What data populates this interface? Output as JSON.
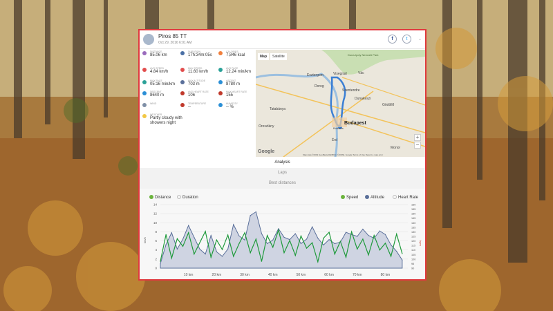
{
  "activity": {
    "title": "Piros 85 TT",
    "date": "Oct 29, 2016 6:01 AM"
  },
  "social": {
    "facebook": "f",
    "twitter": "t",
    "menu": "⌄"
  },
  "stats": [
    {
      "label": "Distance",
      "value": "85.06 km",
      "icon": "route-icon",
      "color": "#9a6bbd"
    },
    {
      "label": "Duration",
      "value": "17h:34m:05s",
      "icon": "clock-icon",
      "color": "#4a6fa5"
    },
    {
      "label": "Calories",
      "value": "7,846 kcal",
      "icon": "flame-icon",
      "color": "#f07f3c"
    },
    {
      "label": "Avg speed",
      "value": "4.84 km/h",
      "icon": "speed-icon",
      "color": "#e24d4d"
    },
    {
      "label": "Max speed",
      "value": "11.60 km/h",
      "icon": "speed-icon",
      "color": "#e24d4d"
    },
    {
      "label": "Avg pace",
      "value": "12.24 min/km",
      "icon": "pace-icon",
      "color": "#2aa198"
    },
    {
      "label": "Max pace",
      "value": "05:16 min/km",
      "icon": "pace-icon",
      "color": "#2aa198"
    },
    {
      "label": "Max altitude",
      "value": "703 m",
      "icon": "mountain-icon",
      "color": "#5a6f9a"
    },
    {
      "label": "Ascent",
      "value": "8780 m",
      "icon": "ascent-icon",
      "color": "#2a8fd6"
    },
    {
      "label": "Descent",
      "value": "8640 m",
      "icon": "descent-icon",
      "color": "#2a8fd6"
    },
    {
      "label": "Avg heart rate",
      "value": "106",
      "icon": "heart-icon",
      "color": "#c0392b"
    },
    {
      "label": "Max heart rate",
      "value": "155",
      "icon": "heart-icon",
      "color": "#c0392b"
    },
    {
      "label": "Wind",
      "value": "",
      "icon": "wind-icon",
      "color": "#7f8fa6"
    },
    {
      "label": "Temperature",
      "value": "--",
      "icon": "thermometer-icon",
      "color": "#c0392b"
    },
    {
      "label": "Humidity",
      "value": "-- %",
      "icon": "droplet-icon",
      "color": "#2a8fd6"
    },
    {
      "label": "Weather",
      "value": "Partly cloudy with showers night",
      "icon": "weather-icon",
      "color": "#f2c744"
    }
  ],
  "map": {
    "tab_map": "Map",
    "tab_satellite": "Satellite",
    "zoom_in": "+",
    "zoom_out": "−",
    "google": "Google",
    "attribution": "Map data ©2019 GeoBasis-DE/BKG (©2009), Google   Terms of Use   Report a map error",
    "places": [
      "Esztergom",
      "Visegrád",
      "Vác",
      "Szentendre",
      "Dunakeszi",
      "Tatabánya",
      "Budapest",
      "Érd",
      "Gödöllő",
      "Monor",
      "Oroszlány",
      "Budaörs",
      "Dorog",
      "Duna-Ipoly Nemzeti Park"
    ]
  },
  "tabs": {
    "analysis": "Analysis",
    "laps": "Laps",
    "best": "Best distances"
  },
  "toggles": {
    "distance": "Distance",
    "duration": "Duration",
    "speed": "Speed",
    "altitude": "Altitude",
    "heart_rate": "Heart Rate"
  },
  "chart_data": {
    "type": "line",
    "x": [
      0,
      2,
      4,
      6,
      8,
      10,
      12,
      14,
      16,
      18,
      20,
      22,
      24,
      26,
      28,
      30,
      32,
      34,
      36,
      38,
      40,
      42,
      44,
      46,
      48,
      50,
      52,
      54,
      56,
      58,
      60,
      62,
      64,
      66,
      68,
      70,
      72,
      74,
      76,
      78,
      80,
      82,
      84,
      86
    ],
    "xlabel": "",
    "x_ticks": [
      "10 km",
      "20 km",
      "30 km",
      "40 km",
      "50 km",
      "60 km",
      "70 km",
      "80 km"
    ],
    "x_tick_values": [
      10,
      20,
      30,
      40,
      50,
      60,
      70,
      80
    ],
    "xlim": [
      0,
      88
    ],
    "ylabel_left": "km/h",
    "ylim_left": [
      0,
      14
    ],
    "y_ticks_left": [
      "0",
      "2",
      "4",
      "6",
      "8",
      "10",
      "12",
      "14"
    ],
    "ylabel_right": "bpm",
    "ylim_right": [
      90,
      160
    ],
    "y_ticks_right": [
      "90",
      "95",
      "100",
      "105",
      "110",
      "115",
      "120",
      "125",
      "130",
      "135",
      "140",
      "145",
      "150",
      "155",
      "160"
    ],
    "series": [
      {
        "name": "Altitude",
        "type": "area",
        "color": "#5a6f9a",
        "fill": "#cfd4e2",
        "axis": "left",
        "values": [
          1,
          5.2,
          7.8,
          4.2,
          6.4,
          9.4,
          6.8,
          4.2,
          3.1,
          7.2,
          3.6,
          2.6,
          4.2,
          9.6,
          7.1,
          6.2,
          11.6,
          12.4,
          7.6,
          5.4,
          6.2,
          8.7,
          6.8,
          6.3,
          7.6,
          5.4,
          6.4,
          9.1,
          6.6,
          5.1,
          6.3,
          5.4,
          5.7,
          7.9,
          7.4,
          7.0,
          8.6,
          7.2,
          6.6,
          8.2,
          7.4,
          5.1,
          3.7,
          1.8
        ]
      },
      {
        "name": "Speed",
        "type": "line",
        "color": "#1f9a3b",
        "axis": "left",
        "values": [
          1.5,
          7.4,
          2.2,
          6.5,
          4.8,
          7.8,
          3.1,
          5.6,
          8.1,
          2.4,
          6.2,
          4.1,
          7.3,
          2.6,
          5.4,
          7.8,
          3.4,
          6.4,
          1.5,
          7.2,
          4.6,
          8.4,
          3.4,
          6.1,
          2.8,
          7.1,
          4.4,
          5.6,
          1.4,
          6.6,
          7.9,
          3.1,
          5.9,
          2.4,
          8.0,
          4.2,
          6.4,
          2.9,
          7.2,
          4.0,
          5.5,
          2.6,
          7.5,
          3.2
        ]
      }
    ]
  }
}
